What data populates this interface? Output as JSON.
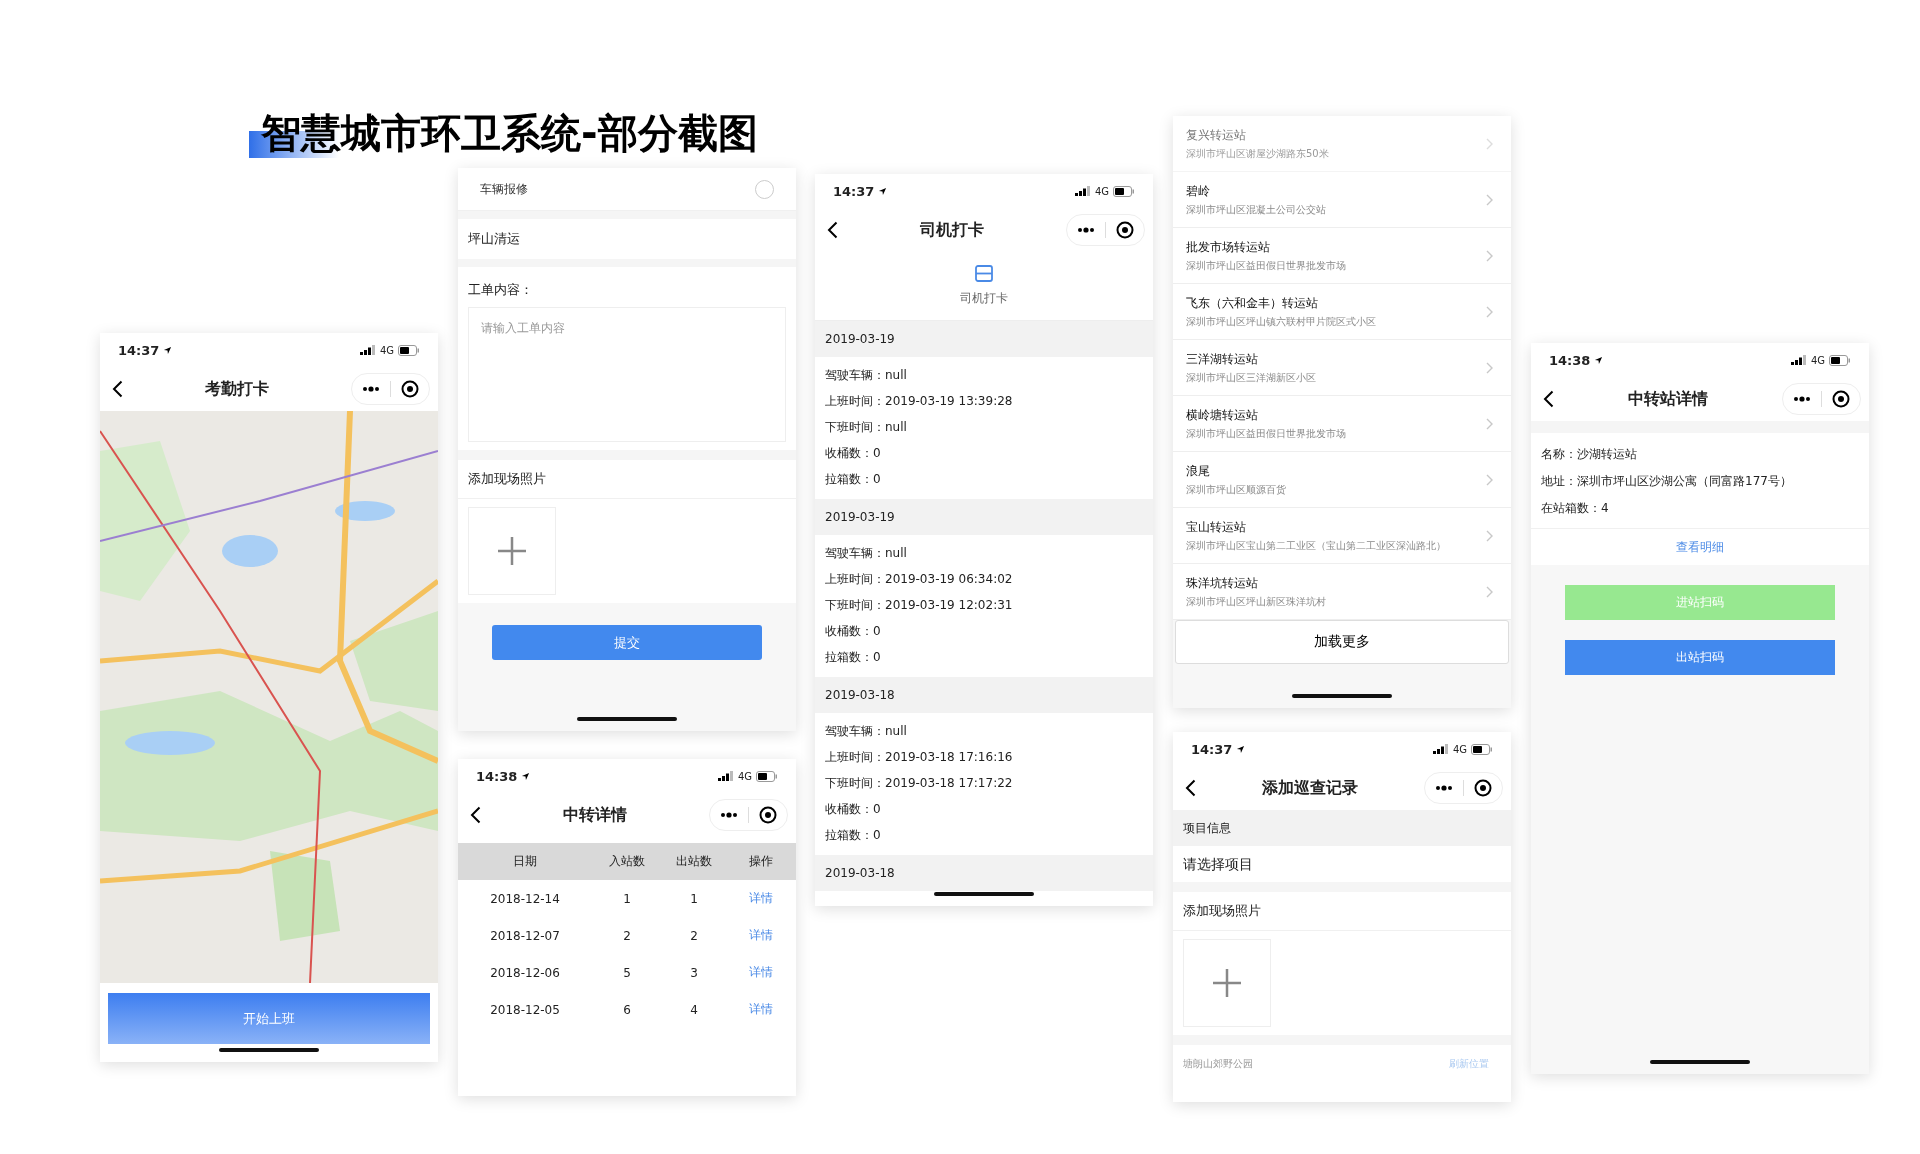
{
  "title": "智慧城市环卫系统-部分截图",
  "phones": [
    {
      "kind": "map",
      "status": {
        "time": "14:37",
        "network": "4G"
      },
      "nav": {
        "title": "考勤打卡"
      },
      "button": "开始上班"
    },
    {
      "kind": "form",
      "options": [
        {
          "label": "车辆报修",
          "checked": false
        }
      ],
      "project": "坪山清运",
      "content": {
        "label": "工单内容：",
        "placeholder": "请输入工单内容"
      },
      "photos_label": "添加现场照片",
      "submit": "提交"
    },
    {
      "kind": "table",
      "status": {
        "time": "14:38",
        "network": "4G"
      },
      "nav": {
        "title": "中转详情"
      },
      "columns": [
        "日期",
        "入站数",
        "出站数",
        "操作"
      ],
      "rows": [
        [
          "2018-12-14",
          "1",
          "1",
          "详情"
        ],
        [
          "2018-12-07",
          "2",
          "2",
          "详情"
        ],
        [
          "2018-12-06",
          "5",
          "3",
          "详情"
        ],
        [
          "2018-12-05",
          "6",
          "4",
          "详情"
        ]
      ]
    },
    {
      "kind": "records",
      "status": {
        "time": "14:37",
        "network": "4G"
      },
      "nav": {
        "title": "司机打卡"
      },
      "tab": {
        "label": "司机打卡"
      },
      "groups": [
        {
          "date": "2019-03-19",
          "lines": [
            "驾驶车辆：null",
            "上班时间：2019-03-19 13:39:28",
            "下班时间：null",
            "收桶数：0",
            "拉箱数：0"
          ]
        },
        {
          "date": "2019-03-19",
          "lines": [
            "驾驶车辆：null",
            "上班时间：2019-03-19 06:34:02",
            "下班时间：2019-03-19 12:02:31",
            "收桶数：0",
            "拉箱数：0"
          ]
        },
        {
          "date": "2019-03-18",
          "lines": [
            "驾驶车辆：null",
            "上班时间：2019-03-18 17:16:16",
            "下班时间：2019-03-18 17:17:22",
            "收桶数：0",
            "拉箱数：0"
          ]
        },
        {
          "date": "2019-03-18"
        }
      ]
    },
    {
      "kind": "stations",
      "items": [
        {
          "name": "复兴转运站",
          "address": "深圳市坪山区谢屋沙湖路东50米",
          "faded": true
        },
        {
          "name": "碧岭",
          "address": "深圳市坪山区混凝土公司公交站",
          "faded": false
        },
        {
          "name": "批发市场转运站",
          "address": "深圳市坪山区益田假日世界批发市场",
          "faded": false
        },
        {
          "name": "飞东（六和金丰）转运站",
          "address": "深圳市坪山区坪山镇六联村甲片院区式小区",
          "faded": false
        },
        {
          "name": "三洋湖转运站",
          "address": "深圳市坪山区三洋湖新区小区",
          "faded": false
        },
        {
          "name": "横岭塘转运站",
          "address": "深圳市坪山区益田假日世界批发市场",
          "faded": false
        },
        {
          "name": "浪尾",
          "address": "深圳市坪山区顺源百货",
          "faded": false
        },
        {
          "name": "宝山转运站",
          "address": "深圳市坪山区宝山第二工业区（宝山第二工业区深汕路北）",
          "faded": false
        },
        {
          "name": "珠洋坑转运站",
          "address": "深圳市坪山区坪山新区珠洋坑村",
          "faded": false
        }
      ],
      "load_more": "加载更多"
    },
    {
      "kind": "patrol",
      "status": {
        "time": "14:37",
        "network": "4G"
      },
      "nav": {
        "title": "添加巡查记录"
      },
      "section": "项目信息",
      "select": "请选择项目",
      "photos_label": "添加现场照片",
      "location": "塘朗山郊野公园",
      "refresh": "刷新位置"
    },
    {
      "kind": "detail",
      "status": {
        "time": "14:38",
        "network": "4G"
      },
      "nav": {
        "title": "中转站详情"
      },
      "fields": [
        "名称：沙湖转运站",
        "地址：深圳市坪山区沙湖公寓（同富路177号）",
        "在站箱数：4"
      ],
      "link": "查看明细",
      "buttons": [
        {
          "label": "进站扫码",
          "color": "#97e890"
        },
        {
          "label": "出站扫码",
          "color": "#4289ee"
        }
      ]
    }
  ]
}
